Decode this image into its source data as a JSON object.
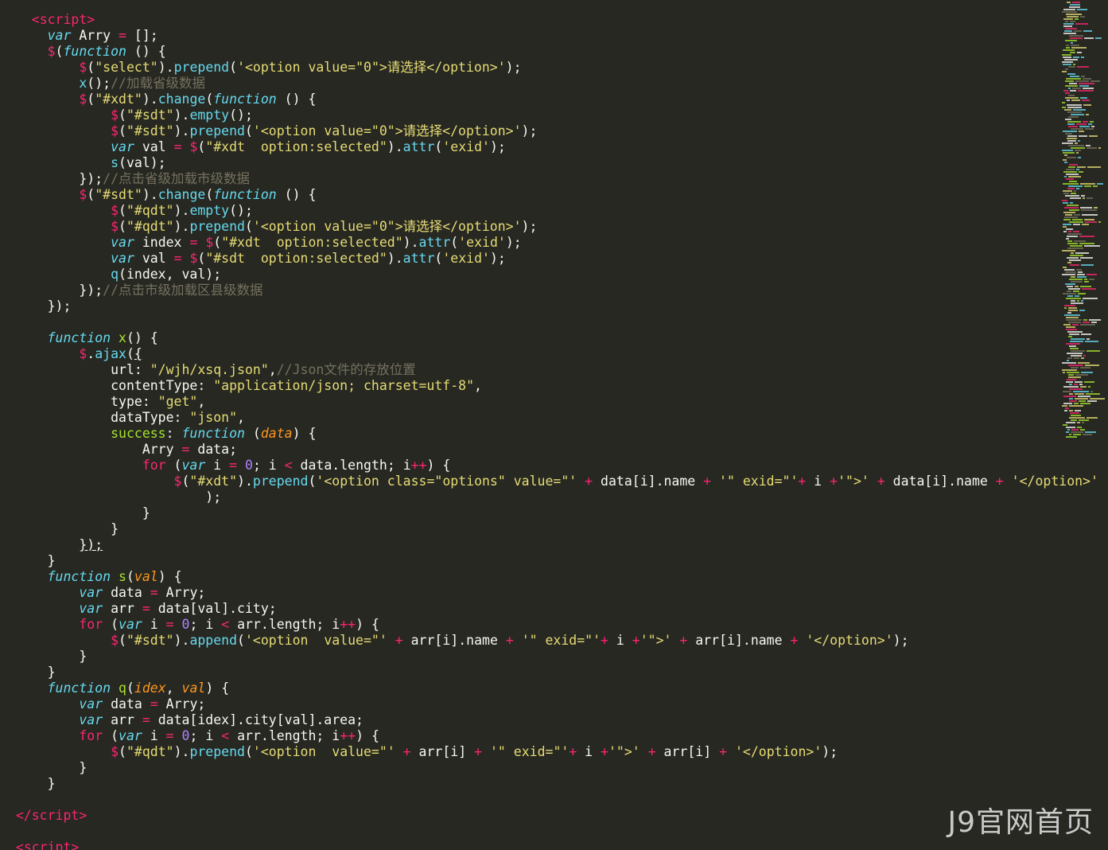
{
  "editor": {
    "theme": "monokai",
    "colors": {
      "background": "#272822",
      "foreground": "#f8f8f2",
      "keyword": "#66d9ef",
      "tag": "#f92672",
      "function_name": "#a6e22e",
      "string": "#e6db74",
      "number": "#ae81ff",
      "parameter": "#fd971f",
      "comment": "#75715e"
    },
    "icons": [
      "minimap-panel"
    ]
  },
  "lines": [
    [
      [
        "    ",
        ""
      ],
      [
        "<",
        "tag"
      ],
      [
        "script",
        "tag"
      ],
      [
        ">",
        "tag"
      ]
    ],
    [
      [
        "      ",
        ""
      ],
      [
        "var",
        "kw"
      ],
      [
        " Arry ",
        ""
      ],
      [
        "=",
        "op"
      ],
      [
        " [];",
        ""
      ]
    ],
    [
      [
        "      ",
        ""
      ],
      [
        "$",
        "dollar"
      ],
      [
        "(",
        ""
      ],
      [
        "function",
        "kw"
      ],
      [
        " () {",
        ""
      ]
    ],
    [
      [
        "          ",
        ""
      ],
      [
        "$",
        "dollar"
      ],
      [
        "(",
        ""
      ],
      [
        "\"select\"",
        "str"
      ],
      [
        ").",
        ""
      ],
      [
        "prepend",
        "method"
      ],
      [
        "(",
        ""
      ],
      [
        "'<option value=\"0\">请选择</option>'",
        "str"
      ],
      [
        ");",
        ""
      ]
    ],
    [
      [
        "          ",
        ""
      ],
      [
        "x",
        "method"
      ],
      [
        "();",
        ""
      ],
      [
        "//加载省级数据",
        "cmt"
      ]
    ],
    [
      [
        "          ",
        ""
      ],
      [
        "$",
        "dollar"
      ],
      [
        "(",
        ""
      ],
      [
        "\"#xdt\"",
        "str"
      ],
      [
        ").",
        ""
      ],
      [
        "change",
        "method"
      ],
      [
        "(",
        ""
      ],
      [
        "function",
        "kw"
      ],
      [
        " () {",
        ""
      ]
    ],
    [
      [
        "              ",
        ""
      ],
      [
        "$",
        "dollar"
      ],
      [
        "(",
        ""
      ],
      [
        "\"#sdt\"",
        "str"
      ],
      [
        ").",
        ""
      ],
      [
        "empty",
        "method"
      ],
      [
        "();",
        ""
      ]
    ],
    [
      [
        "              ",
        ""
      ],
      [
        "$",
        "dollar"
      ],
      [
        "(",
        ""
      ],
      [
        "\"#sdt\"",
        "str"
      ],
      [
        ").",
        ""
      ],
      [
        "prepend",
        "method"
      ],
      [
        "(",
        ""
      ],
      [
        "'<option value=\"0\">请选择</option>'",
        "str"
      ],
      [
        ");",
        ""
      ]
    ],
    [
      [
        "              ",
        ""
      ],
      [
        "var",
        "kw"
      ],
      [
        " val ",
        ""
      ],
      [
        "=",
        "op"
      ],
      [
        " ",
        ""
      ],
      [
        "$",
        "dollar"
      ],
      [
        "(",
        ""
      ],
      [
        "\"#xdt  option:selected\"",
        "str"
      ],
      [
        ").",
        ""
      ],
      [
        "attr",
        "method"
      ],
      [
        "(",
        ""
      ],
      [
        "'exid'",
        "str"
      ],
      [
        ");",
        ""
      ]
    ],
    [
      [
        "              ",
        ""
      ],
      [
        "s",
        "method"
      ],
      [
        "(val);",
        ""
      ]
    ],
    [
      [
        "          ",
        ""
      ],
      [
        "});",
        ""
      ],
      [
        "//点击省级加载市级数据",
        "cmt"
      ]
    ],
    [
      [
        "          ",
        ""
      ],
      [
        "$",
        "dollar"
      ],
      [
        "(",
        ""
      ],
      [
        "\"#sdt\"",
        "str"
      ],
      [
        ").",
        ""
      ],
      [
        "change",
        "method"
      ],
      [
        "(",
        ""
      ],
      [
        "function",
        "kw"
      ],
      [
        " () {",
        ""
      ]
    ],
    [
      [
        "              ",
        ""
      ],
      [
        "$",
        "dollar"
      ],
      [
        "(",
        ""
      ],
      [
        "\"#qdt\"",
        "str"
      ],
      [
        ").",
        ""
      ],
      [
        "empty",
        "method"
      ],
      [
        "();",
        ""
      ]
    ],
    [
      [
        "              ",
        ""
      ],
      [
        "$",
        "dollar"
      ],
      [
        "(",
        ""
      ],
      [
        "\"#qdt\"",
        "str"
      ],
      [
        ").",
        ""
      ],
      [
        "prepend",
        "method"
      ],
      [
        "(",
        ""
      ],
      [
        "'<option value=\"0\">请选择</option>'",
        "str"
      ],
      [
        ");",
        ""
      ]
    ],
    [
      [
        "              ",
        ""
      ],
      [
        "var",
        "kw"
      ],
      [
        " index ",
        ""
      ],
      [
        "=",
        "op"
      ],
      [
        " ",
        ""
      ],
      [
        "$",
        "dollar"
      ],
      [
        "(",
        ""
      ],
      [
        "\"#xdt  option:selected\"",
        "str"
      ],
      [
        ").",
        ""
      ],
      [
        "attr",
        "method"
      ],
      [
        "(",
        ""
      ],
      [
        "'exid'",
        "str"
      ],
      [
        ");",
        ""
      ]
    ],
    [
      [
        "              ",
        ""
      ],
      [
        "var",
        "kw"
      ],
      [
        " val ",
        ""
      ],
      [
        "=",
        "op"
      ],
      [
        " ",
        ""
      ],
      [
        "$",
        "dollar"
      ],
      [
        "(",
        ""
      ],
      [
        "\"#sdt  option:selected\"",
        "str"
      ],
      [
        ").",
        ""
      ],
      [
        "attr",
        "method"
      ],
      [
        "(",
        ""
      ],
      [
        "'exid'",
        "str"
      ],
      [
        ");",
        ""
      ]
    ],
    [
      [
        "              ",
        ""
      ],
      [
        "q",
        "method"
      ],
      [
        "(index, val);",
        ""
      ]
    ],
    [
      [
        "          ",
        ""
      ],
      [
        "});",
        ""
      ],
      [
        "//点击市级加载区县级数据",
        "cmt"
      ]
    ],
    [
      [
        "      ",
        ""
      ],
      [
        "});",
        ""
      ]
    ],
    [
      [
        "",
        ""
      ]
    ],
    [
      [
        "      ",
        ""
      ],
      [
        "function",
        "kw"
      ],
      [
        " ",
        ""
      ],
      [
        "x",
        "fn"
      ],
      [
        "() {",
        ""
      ]
    ],
    [
      [
        "          ",
        ""
      ],
      [
        "$",
        "dollar"
      ],
      [
        ".",
        ""
      ],
      [
        "ajax",
        "method"
      ],
      [
        "(",
        ""
      ],
      [
        "{",
        "ulbrace"
      ]
    ],
    [
      [
        "              ",
        ""
      ],
      [
        "url: ",
        ""
      ],
      [
        "\"/wjh/xsq.json\"",
        "str"
      ],
      [
        ",",
        ""
      ],
      [
        "//Json文件的存放位置",
        "cmt"
      ]
    ],
    [
      [
        "              ",
        ""
      ],
      [
        "contentType: ",
        ""
      ],
      [
        "\"application/json; charset=utf-8\"",
        "str"
      ],
      [
        ",",
        ""
      ]
    ],
    [
      [
        "              ",
        ""
      ],
      [
        "type: ",
        ""
      ],
      [
        "\"get\"",
        "str"
      ],
      [
        ",",
        ""
      ]
    ],
    [
      [
        "              ",
        ""
      ],
      [
        "dataType: ",
        ""
      ],
      [
        "\"json\"",
        "str"
      ],
      [
        ",",
        ""
      ]
    ],
    [
      [
        "              ",
        ""
      ],
      [
        "success",
        "fn"
      ],
      [
        ": ",
        ""
      ],
      [
        "function",
        "kw"
      ],
      [
        " (",
        ""
      ],
      [
        "data",
        "param"
      ],
      [
        ") {",
        ""
      ]
    ],
    [
      [
        "                  ",
        ""
      ],
      [
        "Arry ",
        ""
      ],
      [
        "=",
        "op"
      ],
      [
        " data;",
        ""
      ]
    ],
    [
      [
        "                  ",
        ""
      ],
      [
        "for",
        "ctrl"
      ],
      [
        " (",
        ""
      ],
      [
        "var",
        "kw"
      ],
      [
        " i ",
        ""
      ],
      [
        "=",
        "op"
      ],
      [
        " ",
        ""
      ],
      [
        "0",
        "num"
      ],
      [
        "; i ",
        ""
      ],
      [
        "<",
        "op"
      ],
      [
        " data.length; i",
        ""
      ],
      [
        "++",
        "op"
      ],
      [
        ") {",
        ""
      ]
    ],
    [
      [
        "                      ",
        ""
      ],
      [
        "$",
        "dollar"
      ],
      [
        "(",
        ""
      ],
      [
        "\"#xdt\"",
        "str"
      ],
      [
        ").",
        ""
      ],
      [
        "prepend",
        "method"
      ],
      [
        "(",
        ""
      ],
      [
        "'<option class=\"options\" value=\"'",
        "str"
      ],
      [
        " ",
        ""
      ],
      [
        "+",
        "op"
      ],
      [
        " data[i].name ",
        ""
      ],
      [
        "+",
        "op"
      ],
      [
        " ",
        ""
      ],
      [
        "'\" exid=\"'",
        "str"
      ],
      [
        "+",
        "op"
      ],
      [
        " i ",
        ""
      ],
      [
        "+",
        "op"
      ],
      [
        "'\">'",
        "str"
      ],
      [
        " ",
        ""
      ],
      [
        "+",
        "op"
      ],
      [
        " data[i].name ",
        ""
      ],
      [
        "+",
        "op"
      ],
      [
        " ",
        ""
      ],
      [
        "'</option>'",
        "str"
      ]
    ],
    [
      [
        "                          ",
        ""
      ],
      [
        ");",
        ""
      ]
    ],
    [
      [
        "                  ",
        ""
      ],
      [
        "}",
        ""
      ]
    ],
    [
      [
        "              ",
        ""
      ],
      [
        "}",
        ""
      ]
    ],
    [
      [
        "          ",
        ""
      ],
      [
        "});",
        "ulbrace"
      ]
    ],
    [
      [
        "      ",
        ""
      ],
      [
        "}",
        ""
      ]
    ],
    [
      [
        "      ",
        ""
      ],
      [
        "function",
        "kw"
      ],
      [
        " ",
        ""
      ],
      [
        "s",
        "fn"
      ],
      [
        "(",
        ""
      ],
      [
        "val",
        "param"
      ],
      [
        ") {",
        ""
      ]
    ],
    [
      [
        "          ",
        ""
      ],
      [
        "var",
        "kw"
      ],
      [
        " data ",
        ""
      ],
      [
        "=",
        "op"
      ],
      [
        " Arry;",
        ""
      ]
    ],
    [
      [
        "          ",
        ""
      ],
      [
        "var",
        "kw"
      ],
      [
        " arr ",
        ""
      ],
      [
        "=",
        "op"
      ],
      [
        " data[val].city;",
        ""
      ]
    ],
    [
      [
        "          ",
        ""
      ],
      [
        "for",
        "ctrl"
      ],
      [
        " (",
        ""
      ],
      [
        "var",
        "kw"
      ],
      [
        " i ",
        ""
      ],
      [
        "=",
        "op"
      ],
      [
        " ",
        ""
      ],
      [
        "0",
        "num"
      ],
      [
        "; i ",
        ""
      ],
      [
        "<",
        "op"
      ],
      [
        " arr.length; i",
        ""
      ],
      [
        "++",
        "op"
      ],
      [
        ") {",
        ""
      ]
    ],
    [
      [
        "              ",
        ""
      ],
      [
        "$",
        "dollar"
      ],
      [
        "(",
        ""
      ],
      [
        "\"#sdt\"",
        "str"
      ],
      [
        ").",
        ""
      ],
      [
        "append",
        "method"
      ],
      [
        "(",
        ""
      ],
      [
        "'<option  value=\"'",
        "str"
      ],
      [
        " ",
        ""
      ],
      [
        "+",
        "op"
      ],
      [
        " arr[i].name ",
        ""
      ],
      [
        "+",
        "op"
      ],
      [
        " ",
        ""
      ],
      [
        "'\" exid=\"'",
        "str"
      ],
      [
        "+",
        "op"
      ],
      [
        " i ",
        ""
      ],
      [
        "+",
        "op"
      ],
      [
        "'\">'",
        "str"
      ],
      [
        " ",
        ""
      ],
      [
        "+",
        "op"
      ],
      [
        " arr[i].name ",
        ""
      ],
      [
        "+",
        "op"
      ],
      [
        " ",
        ""
      ],
      [
        "'</option>'",
        "str"
      ],
      [
        ");",
        ""
      ]
    ],
    [
      [
        "          ",
        ""
      ],
      [
        "}",
        ""
      ]
    ],
    [
      [
        "      ",
        ""
      ],
      [
        "}",
        ""
      ]
    ],
    [
      [
        "      ",
        ""
      ],
      [
        "function",
        "kw"
      ],
      [
        " ",
        ""
      ],
      [
        "q",
        "fn"
      ],
      [
        "(",
        ""
      ],
      [
        "idex",
        "param"
      ],
      [
        ", ",
        ""
      ],
      [
        "val",
        "param"
      ],
      [
        ") {",
        ""
      ]
    ],
    [
      [
        "          ",
        ""
      ],
      [
        "var",
        "kw"
      ],
      [
        " data ",
        ""
      ],
      [
        "=",
        "op"
      ],
      [
        " Arry;",
        ""
      ]
    ],
    [
      [
        "          ",
        ""
      ],
      [
        "var",
        "kw"
      ],
      [
        " arr ",
        ""
      ],
      [
        "=",
        "op"
      ],
      [
        " data[idex].city[val].area;",
        ""
      ]
    ],
    [
      [
        "          ",
        ""
      ],
      [
        "for",
        "ctrl"
      ],
      [
        " (",
        ""
      ],
      [
        "var",
        "kw"
      ],
      [
        " i ",
        ""
      ],
      [
        "=",
        "op"
      ],
      [
        " ",
        ""
      ],
      [
        "0",
        "num"
      ],
      [
        "; i ",
        ""
      ],
      [
        "<",
        "op"
      ],
      [
        " arr.length; i",
        ""
      ],
      [
        "++",
        "op"
      ],
      [
        ") {",
        ""
      ]
    ],
    [
      [
        "              ",
        ""
      ],
      [
        "$",
        "dollar"
      ],
      [
        "(",
        ""
      ],
      [
        "\"#qdt\"",
        "str"
      ],
      [
        ").",
        ""
      ],
      [
        "prepend",
        "method"
      ],
      [
        "(",
        ""
      ],
      [
        "'<option  value=\"'",
        "str"
      ],
      [
        " ",
        ""
      ],
      [
        "+",
        "op"
      ],
      [
        " arr[i] ",
        ""
      ],
      [
        "+",
        "op"
      ],
      [
        " ",
        ""
      ],
      [
        "'\" exid=\"'",
        "str"
      ],
      [
        "+",
        "op"
      ],
      [
        " i ",
        ""
      ],
      [
        "+",
        "op"
      ],
      [
        "'\">'",
        "str"
      ],
      [
        " ",
        ""
      ],
      [
        "+",
        "op"
      ],
      [
        " arr[i] ",
        ""
      ],
      [
        "+",
        "op"
      ],
      [
        " ",
        ""
      ],
      [
        "'</option>'",
        "str"
      ],
      [
        ");",
        ""
      ]
    ],
    [
      [
        "          ",
        ""
      ],
      [
        "}",
        ""
      ]
    ],
    [
      [
        "      ",
        ""
      ],
      [
        "}",
        ""
      ]
    ],
    [
      [
        "",
        ""
      ]
    ],
    [
      [
        "  ",
        ""
      ],
      [
        "</",
        "tag"
      ],
      [
        "script",
        "tag"
      ],
      [
        ">",
        "tag"
      ]
    ],
    [
      [
        "",
        ""
      ]
    ],
    [
      [
        "  ",
        ""
      ],
      [
        "<",
        "tag"
      ],
      [
        "script",
        "tag"
      ],
      [
        ">",
        "tag"
      ]
    ]
  ],
  "watermark": {
    "text": "J9官网首页"
  }
}
